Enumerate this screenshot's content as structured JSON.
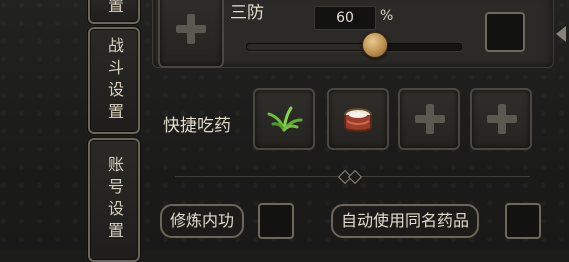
{
  "tabs": [
    {
      "label": "置"
    },
    {
      "label": "战斗设置"
    },
    {
      "label": "账号设置"
    }
  ],
  "defense": {
    "label": "三防",
    "percent_value": "60",
    "percent_unit": "%",
    "slider_level_percent": 60,
    "checkbox_checked": false
  },
  "quick_use": {
    "label": "快捷吃药",
    "slots": [
      {
        "item": "herb-icon"
      },
      {
        "item": "drum-icon"
      },
      {
        "item": "empty-plus"
      },
      {
        "item": "empty-plus"
      }
    ]
  },
  "options": [
    {
      "label": "修炼内功",
      "checked": false
    },
    {
      "label": "自动使用同名药品",
      "checked": false
    }
  ]
}
